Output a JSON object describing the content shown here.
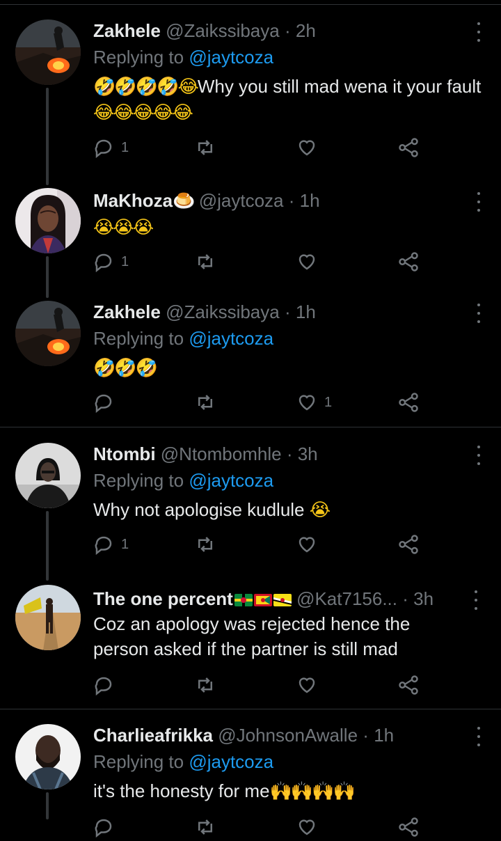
{
  "reply_prefix": "Replying to",
  "tweets": [
    {
      "name": "Zakhele",
      "handle": "@Zaikssibaya",
      "dot": "·",
      "time": "2h",
      "replying_to": "@jaytcoza",
      "text_emoji_lead": "🤣🤣🤣🤣😂",
      "text": "Why you still mad wena it your fault",
      "text_emoji_trail": "😂😂😂😂😂",
      "reply_count": "1",
      "retweet_count": "",
      "like_count": ""
    },
    {
      "name": "MaKhoza",
      "name_emoji": "🍮",
      "handle": "@jaytcoza",
      "dot": "·",
      "time": "1h",
      "text_emoji_lead": "😭😭😭",
      "reply_count": "1",
      "retweet_count": "",
      "like_count": ""
    },
    {
      "name": "Zakhele",
      "handle": "@Zaikssibaya",
      "dot": "·",
      "time": "1h",
      "replying_to": "@jaytcoza",
      "text_emoji_lead": "🤣🤣🤣",
      "reply_count": "",
      "retweet_count": "",
      "like_count": "1"
    },
    {
      "name": "Ntombi",
      "handle": "@Ntombomhle",
      "dot": "·",
      "time": "3h",
      "replying_to": "@jaytcoza",
      "text": "Why not apologise kudlule",
      "text_emoji_trail": "😭",
      "reply_count": "1",
      "retweet_count": "",
      "like_count": ""
    },
    {
      "name": "The one percent",
      "handle": "@Kat7156...",
      "dot": "·",
      "time": "3h",
      "text": "Coz an apology was rejected hence the person asked if the partner is still mad",
      "reply_count": "",
      "retweet_count": "",
      "like_count": ""
    },
    {
      "name": "Charlieafrikka",
      "handle": "@JohnsonAwalle",
      "dot": "·",
      "time": "1h",
      "replying_to": "@jaytcoza",
      "text": "it's the honesty for me",
      "text_emoji_trail": "🙌🙌🙌🙌",
      "reply_count": "",
      "retweet_count": "",
      "like_count": ""
    }
  ],
  "colors": {
    "background": "#000000",
    "text": "#e7e9ea",
    "muted": "#71767b",
    "link": "#1d9bf0",
    "divider": "#2f3336"
  },
  "icons": [
    "reply-icon",
    "retweet-icon",
    "like-icon",
    "share-icon",
    "more-icon"
  ]
}
